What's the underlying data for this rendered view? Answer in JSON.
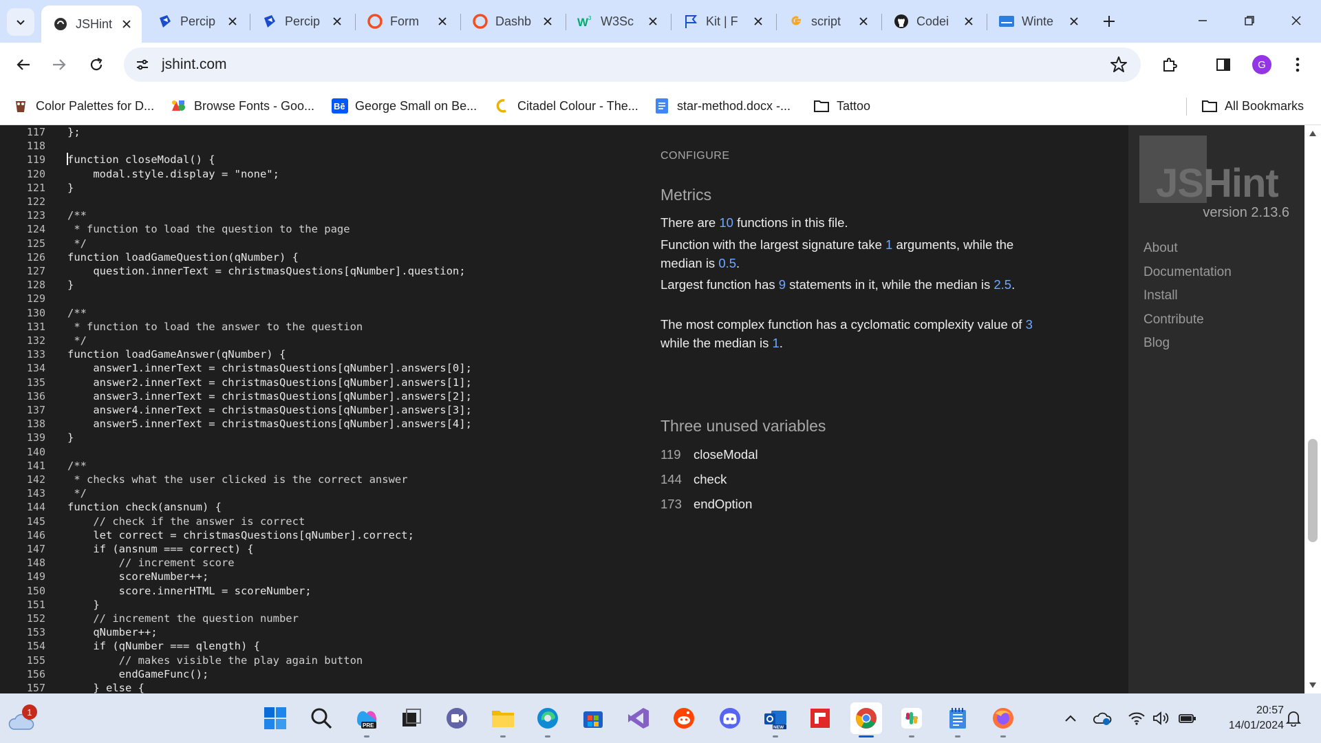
{
  "browser": {
    "tabs": [
      {
        "title": "JSHint",
        "active": true,
        "icon": "jshint-favicon"
      },
      {
        "title": "Percip",
        "active": false,
        "icon": "percipio-favicon"
      },
      {
        "title": "Percip",
        "active": false,
        "icon": "percipio-favicon"
      },
      {
        "title": "Form",
        "active": false,
        "icon": "form-favicon"
      },
      {
        "title": "Dashb",
        "active": false,
        "icon": "dashboard-favicon"
      },
      {
        "title": "W3Sc",
        "active": false,
        "icon": "w3schools-favicon"
      },
      {
        "title": "Kit | F",
        "active": false,
        "icon": "flag-favicon"
      },
      {
        "title": "script",
        "active": false,
        "icon": "g-favicon"
      },
      {
        "title": "Codei",
        "active": false,
        "icon": "github-favicon"
      },
      {
        "title": "Winte",
        "active": false,
        "icon": "winter-favicon"
      }
    ],
    "url": "jshint.com",
    "profile_initial": "G",
    "bookmarks": [
      {
        "label": "Color Palettes for D...",
        "icon": "palette-icon"
      },
      {
        "label": "Browse Fonts - Goo...",
        "icon": "fonts-icon"
      },
      {
        "label": "George Small on Be...",
        "icon": "behance-icon"
      },
      {
        "label": "Citadel Colour - The...",
        "icon": "citadel-icon"
      },
      {
        "label": "star-method.docx -...",
        "icon": "docs-icon"
      },
      {
        "label": "Tattoo",
        "icon": "folder-icon"
      }
    ],
    "all_bookmarks": "All Bookmarks"
  },
  "editor": {
    "lines": [
      {
        "n": "117",
        "code": "};"
      },
      {
        "n": "118",
        "code": ""
      },
      {
        "n": "119",
        "code": "function closeModal() {"
      },
      {
        "n": "120",
        "code": "    modal.style.display = \"none\";"
      },
      {
        "n": "121",
        "code": "}"
      },
      {
        "n": "122",
        "code": ""
      },
      {
        "n": "123",
        "code": "/**"
      },
      {
        "n": "124",
        "code": " * function to load the question to the page"
      },
      {
        "n": "125",
        "code": " */"
      },
      {
        "n": "126",
        "code": "function loadGameQuestion(qNumber) {"
      },
      {
        "n": "127",
        "code": "    question.innerText = christmasQuestions[qNumber].question;"
      },
      {
        "n": "128",
        "code": "}"
      },
      {
        "n": "129",
        "code": ""
      },
      {
        "n": "130",
        "code": "/**"
      },
      {
        "n": "131",
        "code": " * function to load the answer to the question"
      },
      {
        "n": "132",
        "code": " */"
      },
      {
        "n": "133",
        "code": "function loadGameAnswer(qNumber) {"
      },
      {
        "n": "134",
        "code": "    answer1.innerText = christmasQuestions[qNumber].answers[0];"
      },
      {
        "n": "135",
        "code": "    answer2.innerText = christmasQuestions[qNumber].answers[1];"
      },
      {
        "n": "136",
        "code": "    answer3.innerText = christmasQuestions[qNumber].answers[2];"
      },
      {
        "n": "137",
        "code": "    answer4.innerText = christmasQuestions[qNumber].answers[3];"
      },
      {
        "n": "138",
        "code": "    answer5.innerText = christmasQuestions[qNumber].answers[4];"
      },
      {
        "n": "139",
        "code": "}"
      },
      {
        "n": "140",
        "code": ""
      },
      {
        "n": "141",
        "code": "/**"
      },
      {
        "n": "142",
        "code": " * checks what the user clicked is the correct answer"
      },
      {
        "n": "143",
        "code": " */"
      },
      {
        "n": "144",
        "code": "function check(ansnum) {"
      },
      {
        "n": "145",
        "code": "    // check if the answer is correct"
      },
      {
        "n": "146",
        "code": "    let correct = christmasQuestions[qNumber].correct;"
      },
      {
        "n": "147",
        "code": "    if (ansnum === correct) {"
      },
      {
        "n": "148",
        "code": "        // increment score"
      },
      {
        "n": "149",
        "code": "        scoreNumber++;"
      },
      {
        "n": "150",
        "code": "        score.innerHTML = scoreNumber;"
      },
      {
        "n": "151",
        "code": "    }"
      },
      {
        "n": "152",
        "code": "    // increment the question number"
      },
      {
        "n": "153",
        "code": "    qNumber++;"
      },
      {
        "n": "154",
        "code": "    if (qNumber === qlength) {"
      },
      {
        "n": "155",
        "code": "        // makes visible the play again button"
      },
      {
        "n": "156",
        "code": "        endGameFunc();"
      },
      {
        "n": "157",
        "code": "    } else {"
      }
    ]
  },
  "report": {
    "configure": "CONFIGURE",
    "metrics_title": "Metrics",
    "functions_count": {
      "pre": "There are ",
      "num": "10",
      "post": " functions in this file."
    },
    "signature": {
      "pre": "Function with the largest signature take ",
      "num1": "1",
      "mid": " arguments, while the median is ",
      "num2": "0.5",
      "post": "."
    },
    "statements": {
      "pre": "Largest function has ",
      "num1": "9",
      "mid": " statements in it, while the median is ",
      "num2": "2.5",
      "post": "."
    },
    "complexity": {
      "pre": "The most complex function has a cyclomatic complexity value of ",
      "num1": "3",
      "mid": " while the median is ",
      "num2": "1",
      "post": "."
    },
    "unused_title": "Three unused variables",
    "unused": [
      {
        "line": "119",
        "name": "closeModal"
      },
      {
        "line": "144",
        "name": "check"
      },
      {
        "line": "173",
        "name": "endOption"
      }
    ]
  },
  "sidebar": {
    "logo_text": "JSHint",
    "version": "version 2.13.6",
    "links": [
      "About",
      "Documentation",
      "Install",
      "Contribute",
      "Blog"
    ]
  },
  "taskbar": {
    "weather_badge": "1",
    "apps": [
      "windows-start-icon",
      "search-icon",
      "copilot-icon",
      "task-view-icon",
      "teams-icon",
      "file-explorer-icon",
      "edge-icon",
      "store-icon",
      "visual-studio-icon",
      "reddit-icon",
      "discord-icon",
      "outlook-icon",
      "flipboard-icon",
      "chrome-icon",
      "slack-icon",
      "notepad-icon",
      "firefox-icon"
    ],
    "time": "20:57",
    "date": "14/01/2024"
  }
}
